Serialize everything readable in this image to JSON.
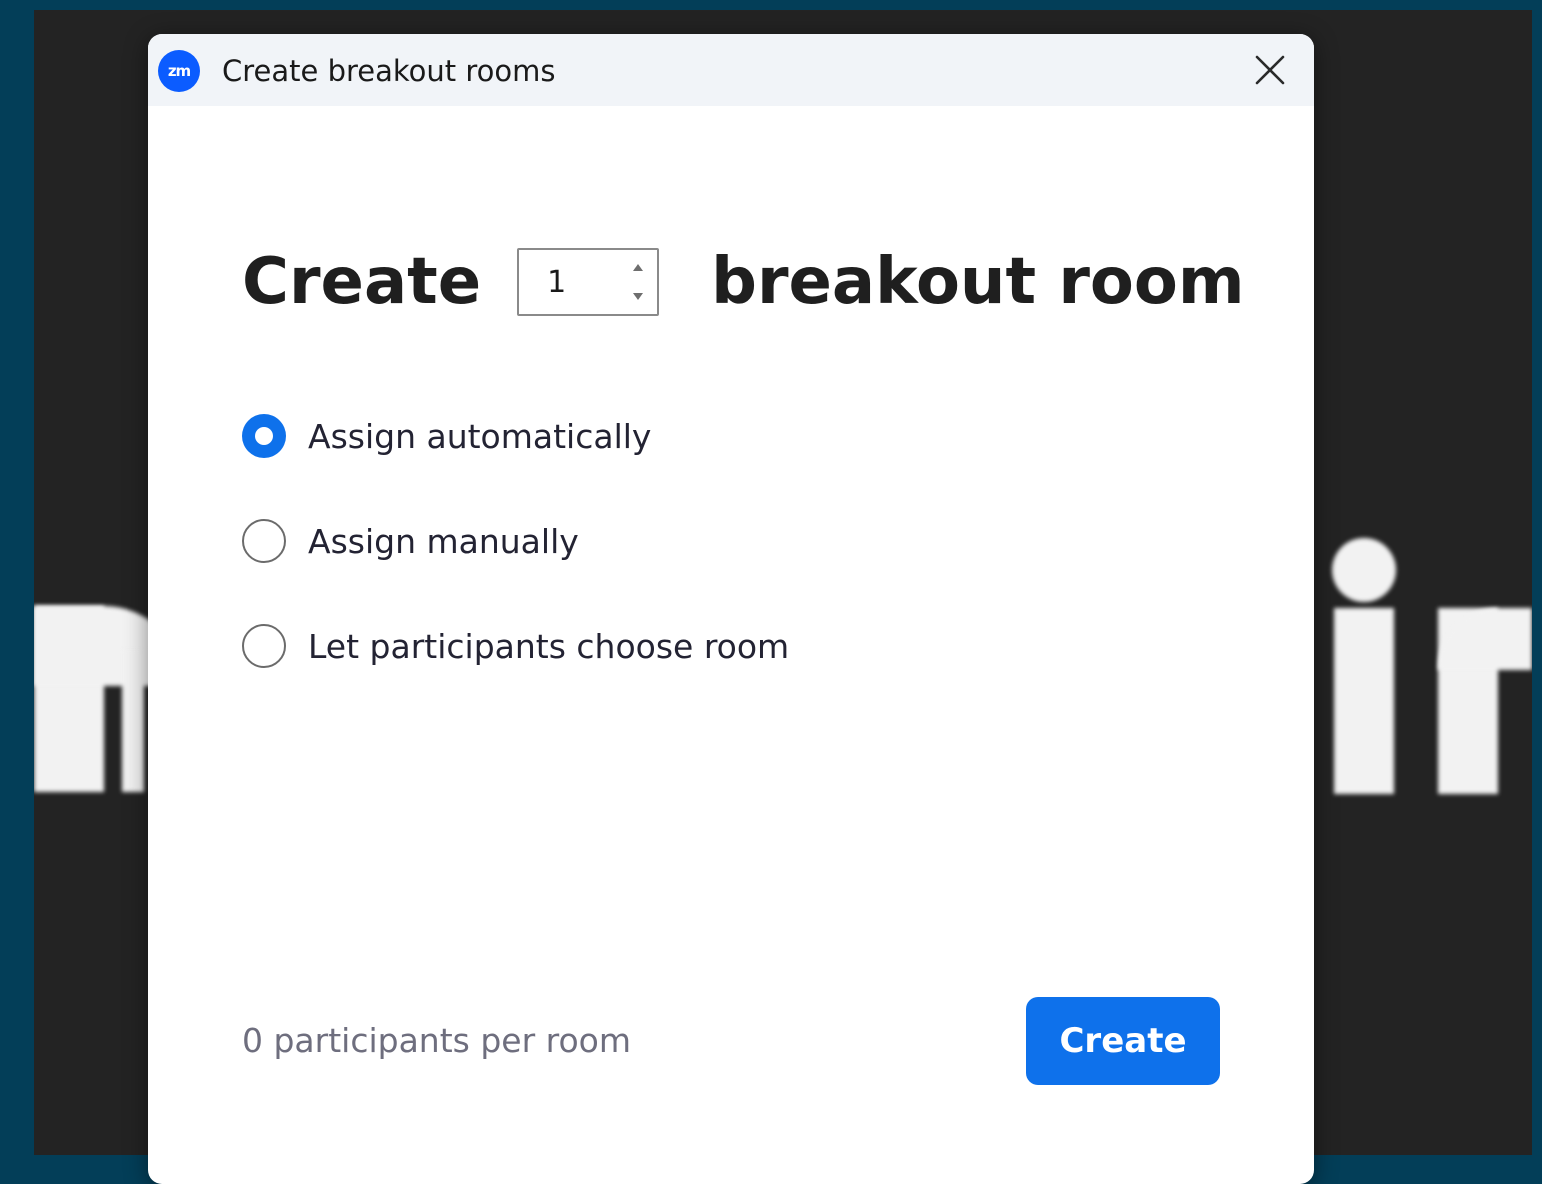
{
  "window": {
    "app_icon_text": "zm",
    "title": "Create breakout rooms"
  },
  "headline": {
    "prefix": "Create",
    "room_count": "1",
    "suffix": "breakout room"
  },
  "options": [
    {
      "label": "Assign automatically",
      "selected": true
    },
    {
      "label": "Assign manually",
      "selected": false
    },
    {
      "label": "Let participants choose room",
      "selected": false
    }
  ],
  "footer": {
    "participants_text": "0 participants per room",
    "create_label": "Create"
  },
  "colors": {
    "accent": "#0e71eb",
    "app_icon": "#0b5cff",
    "outer_background": "#033e58",
    "titlebar": "#f1f4f8"
  },
  "icons": {
    "app": "zoom-logo-icon",
    "close": "close-icon",
    "stepper_up": "chevron-up-icon",
    "stepper_down": "chevron-down-icon"
  }
}
